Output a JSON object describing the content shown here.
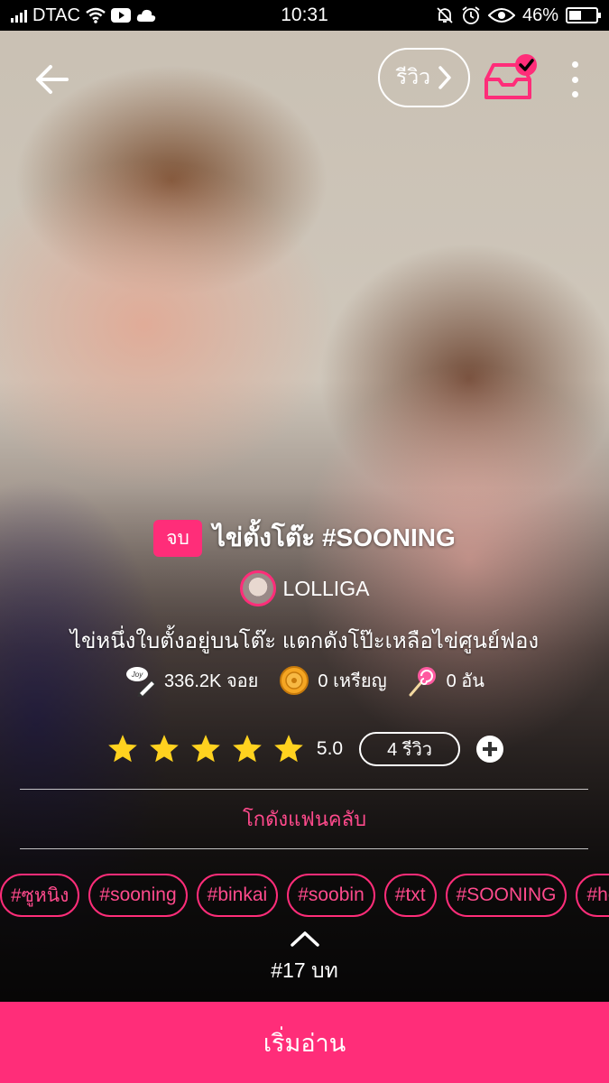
{
  "status_bar": {
    "carrier": "DTAC",
    "time": "10:31",
    "battery": "46%",
    "battery_level": 0.46,
    "icons": [
      "signal-icon",
      "wifi-icon",
      "youtube-icon",
      "cloud-icon",
      "mute-icon",
      "alarm-icon",
      "eye-icon",
      "battery-icon"
    ]
  },
  "header": {
    "review_label": "รีวิว",
    "icons": [
      "back-arrow-icon",
      "chevron-right-icon",
      "library-check-icon",
      "more-vertical-icon"
    ]
  },
  "story": {
    "status_badge": "จบ",
    "title": "ไข่ตั้งโต๊ะ #SOONING",
    "author": "LOLLIGA",
    "description": "ไข่หนึ่งใบตั้งอยู่บนโต๊ะ แตกดังโป๊ะเหลือไข่ศูนย์ฟอง",
    "stats": {
      "joy": "336.2K จอย",
      "coins": "0 เหรียญ",
      "candy": "0 อัน"
    },
    "rating": {
      "stars": 5,
      "score": "5.0",
      "reviews": "4 รีวิว"
    },
    "fanclub_label": "โกดังแฟนคลับ",
    "tags": [
      "#ซูหนิง",
      "#sooning",
      "#binkai",
      "#soobin",
      "#txt",
      "#SOONING",
      "#ho"
    ],
    "chapters": "#17 บท"
  },
  "cta": {
    "start_label": "เริ่มอ่าน"
  },
  "colors": {
    "accent": "#ff2d79",
    "accent_text": "#ff4a8c",
    "star": "#ffd21f"
  }
}
